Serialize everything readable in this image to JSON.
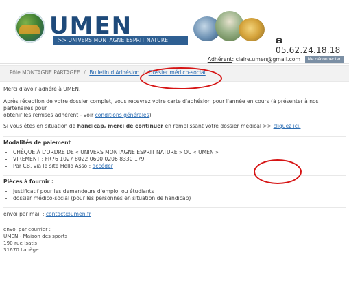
{
  "header": {
    "brand": "UMEN",
    "brand_sub": ">> UNIVERS MONTAGNE ESPRIT NATURE",
    "phone": "05.62.24.18.18"
  },
  "account": {
    "member_label": "Adhérent",
    "email": "claire.umen@gmail.com",
    "logout": "Me déconnecter"
  },
  "breadcrumb": {
    "item1": "Pôle MONTAGNE PARTAGÉE",
    "item2": "Bulletin d'Adhésion",
    "item3": "Dossier médico-social"
  },
  "content": {
    "greeting": "Merci d'avoir adhéré à UMEN,",
    "intro_1": "Après réception de votre dossier complet, vous recevrez votre carte d'adhésion pour l'année en cours (à présenter à nos partenaires pour",
    "intro_2": "obtenir les remises adhérent - voir ",
    "intro_link": "conditions générales",
    "intro_end": ")",
    "handicap_pre": "Si vous êtes en situation de ",
    "handicap_bold": "handicap, merci de continuer",
    "handicap_post": " en remplissant votre dossier médical >> ",
    "handicap_link": "cliquez ici.",
    "payment_heading": "Modalités de paiement",
    "payment_items": [
      "CHÈQUE À L'ORDRE DE « UNIVERS MONTAGNE ESPRIT NATURE » OU « UMEN »",
      "VIREMENT : FR76 1027 8022 0600 0206 8330 179"
    ],
    "payment_cb_pre": "Par CB, via le site Hello Asso : ",
    "payment_cb_link": "accéder",
    "docs_heading": "Pièces à fournir :",
    "docs_items": [
      "justificatif pour les demandeurs d'emploi ou étudiants",
      "dossier médico-social (pour les personnes en situation de handicap)"
    ],
    "mail_pre": "envoi par mail : ",
    "mail_link": "contact@umen.fr",
    "post_lines": [
      "envoi par courrier :",
      "UMEN - Maison des sports",
      "190 rue Isatis",
      "31670 Labège"
    ]
  },
  "colors": {
    "brand_blue": "#1e4a7a",
    "link_blue": "#2c6db3",
    "annotation_red": "#d61414"
  },
  "icons": {
    "phone": "phone-icon",
    "logo": "mountain-logo-icon"
  }
}
